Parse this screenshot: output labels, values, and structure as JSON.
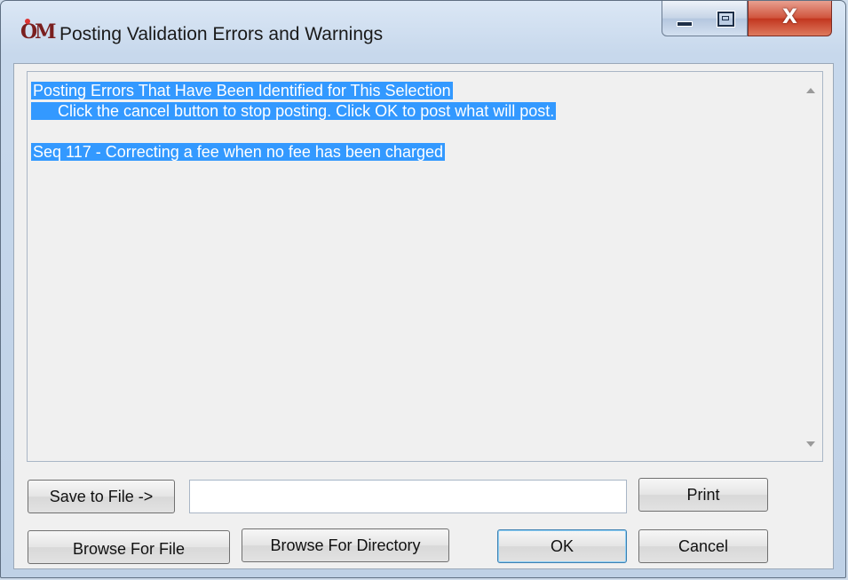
{
  "window": {
    "title": "Posting Validation Errors and Warnings",
    "app_icon_text": "OM",
    "close_glyph": "X"
  },
  "messages": {
    "lines": [
      "Posting Errors That Have Been Identified for This Selection",
      "Click the cancel button to stop posting. Click OK to post what will post.",
      "",
      "Seq 117 - Correcting a fee when no fee has been charged"
    ],
    "selection_color": "#3399ff"
  },
  "buttons": {
    "save_to_file": "Save to File ->",
    "print": "Print",
    "browse_file": "Browse For File",
    "browse_directory": "Browse For Directory",
    "ok": "OK",
    "cancel": "Cancel"
  },
  "file_path": {
    "value": "",
    "placeholder": ""
  }
}
